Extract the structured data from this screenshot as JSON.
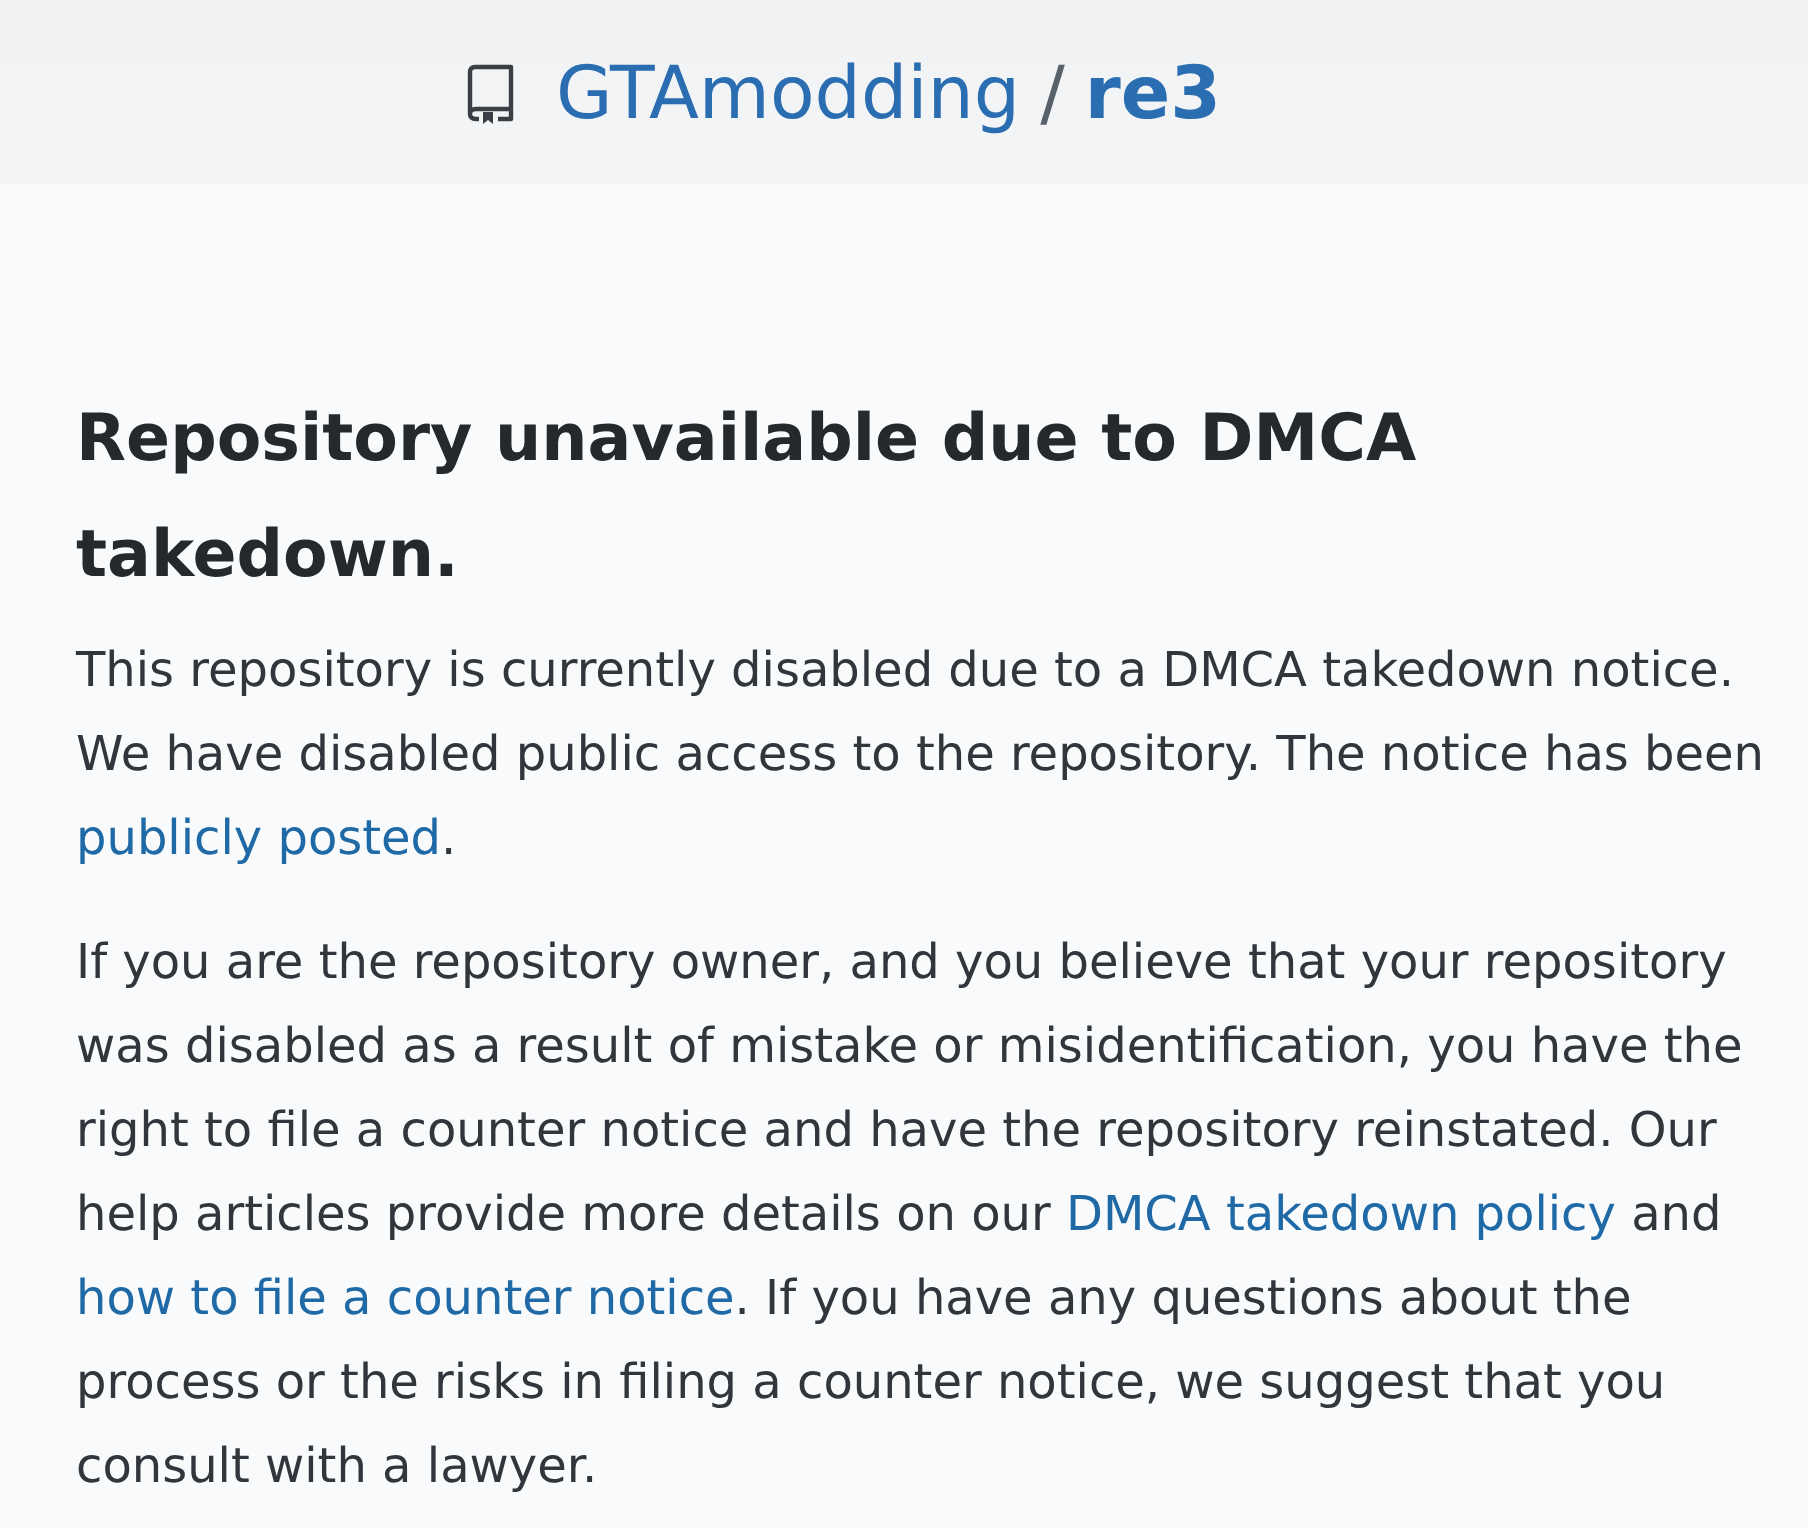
{
  "header": {
    "owner": "GTAmodding",
    "separator": "/",
    "repository": "re3"
  },
  "notice": {
    "title": "Repository unavailable due to DMCA takedown.",
    "paragraphs": [
      [
        {
          "kind": "text",
          "text": "This repository is currently disabled due to a DMCA takedown notice. We have disabled public access to the repository. The notice has been "
        },
        {
          "kind": "link",
          "text": "publicly posted"
        },
        {
          "kind": "text",
          "text": "."
        }
      ],
      [
        {
          "kind": "text",
          "text": "If you are the repository owner, and you believe that your repository was disabled as a result of mistake or misidentification, you have the right to file a counter notice and have the repository reinstated. Our help articles provide more details on our "
        },
        {
          "kind": "link",
          "text": "DMCA takedown policy"
        },
        {
          "kind": "text",
          "text": " and "
        },
        {
          "kind": "link",
          "text": "how to file a counter notice"
        },
        {
          "kind": "text",
          "text": ". If you have any questions about the process or the risks in filing a counter notice, we suggest that you consult with a lawyer."
        }
      ]
    ]
  }
}
